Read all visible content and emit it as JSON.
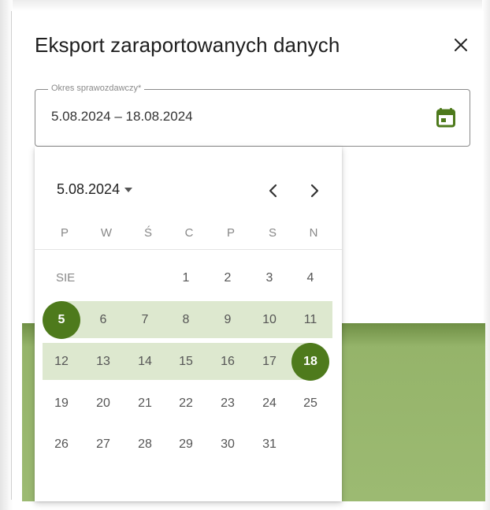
{
  "dialog": {
    "title": "Eksport zaraportowanych danych",
    "close_icon": "close-icon"
  },
  "field": {
    "label": "Okres sprawozdawczy*",
    "value": "5.08.2024 – 18.08.2024",
    "calendar_icon": "calendar-icon"
  },
  "picker": {
    "current_period": "5.08.2024",
    "month_abbr": "SIE",
    "weekdays": [
      "P",
      "W",
      "Ś",
      "C",
      "P",
      "S",
      "N"
    ],
    "weeks": [
      [
        "",
        "",
        "",
        "1",
        "2",
        "3",
        "4"
      ],
      [
        "5",
        "6",
        "7",
        "8",
        "9",
        "10",
        "11"
      ],
      [
        "12",
        "13",
        "14",
        "15",
        "16",
        "17",
        "18"
      ],
      [
        "19",
        "20",
        "21",
        "22",
        "23",
        "24",
        "25"
      ],
      [
        "26",
        "27",
        "28",
        "29",
        "30",
        "31",
        ""
      ]
    ],
    "range_start": "5",
    "range_end": "18"
  },
  "colors": {
    "accent": "#4e7a1c",
    "range_fill": "#dde8cf",
    "background_green": "#9cba72"
  }
}
